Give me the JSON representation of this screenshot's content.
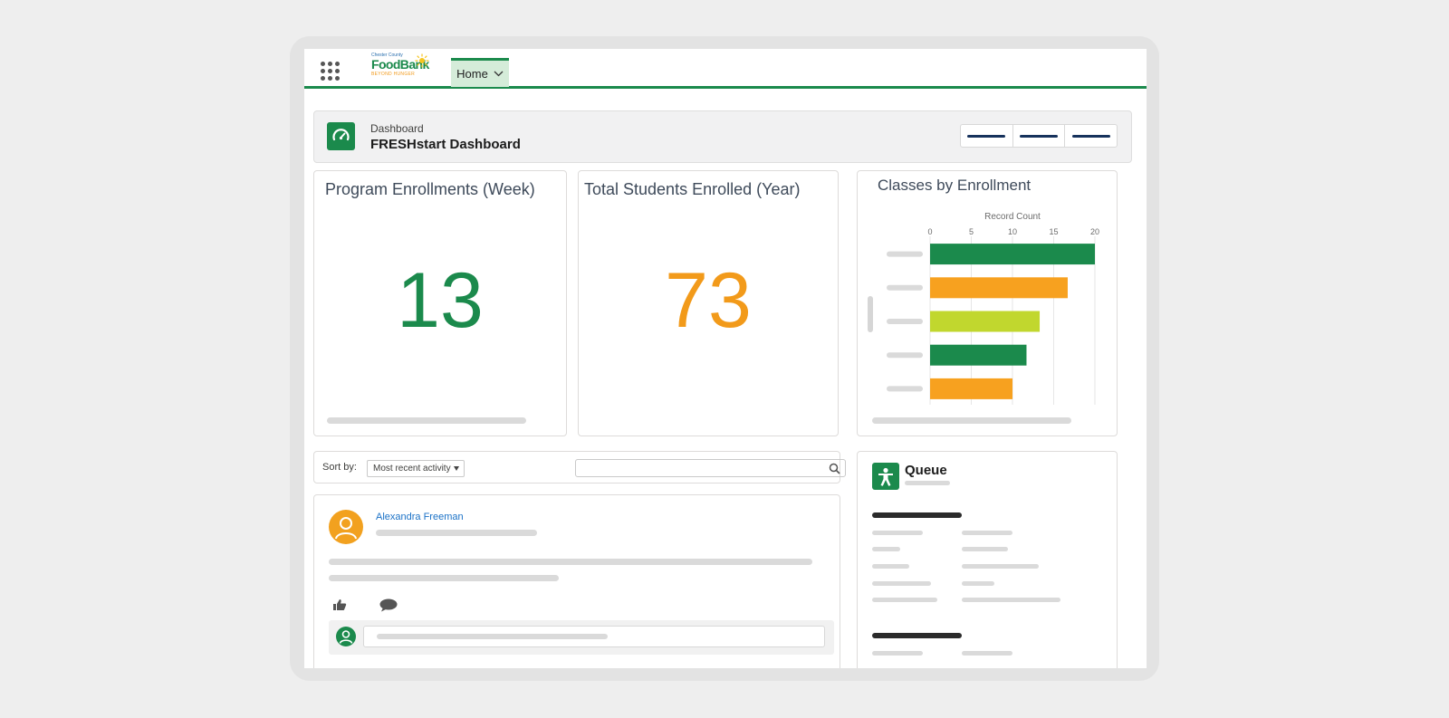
{
  "topnav": {
    "logo": {
      "line1": "Chester County",
      "line2": "FoodBank",
      "line3": "BEYOND HUNGER"
    },
    "home_tab": "Home"
  },
  "header": {
    "label": "Dashboard",
    "title": "FRESHstart Dashboard"
  },
  "metrics": [
    {
      "title": "Program Enrollments (Week)",
      "value": "13",
      "color": "#1b8a4c"
    },
    {
      "title": "Total Students Enrolled (Year)",
      "value": "73",
      "color": "#f29a1a"
    }
  ],
  "classes_chart": {
    "title": "Classes by Enrollment",
    "chart_data": {
      "type": "bar",
      "orientation": "horizontal",
      "xlabel": "Record Count",
      "xlim": [
        0,
        20
      ],
      "ticks": [
        "0",
        "5",
        "10",
        "15",
        "20"
      ],
      "values": [
        20,
        16.7,
        13.3,
        11.7,
        10
      ],
      "colors": [
        "#1b8a4c",
        "#f7a11f",
        "#c1d72e",
        "#1b8a4c",
        "#f7a11f"
      ],
      "grid": true
    }
  },
  "feed": {
    "sort_label": "Sort by:",
    "sort_value": "Most recent activity",
    "post_author": "Alexandra Freeman"
  },
  "queue": {
    "title": "Queue"
  },
  "colors": {
    "brand_green": "#1b8a4c",
    "accent_orange": "#f29a1a",
    "lime": "#c1d72e",
    "link_blue": "#1b72c7"
  },
  "icons": {
    "launcher": "app-launcher-icon",
    "dashboard": "gauge-icon",
    "search": "search-icon",
    "like": "thumbs-up-icon",
    "comment": "comment-icon",
    "queue": "person-icon",
    "avatar": "user-icon"
  }
}
